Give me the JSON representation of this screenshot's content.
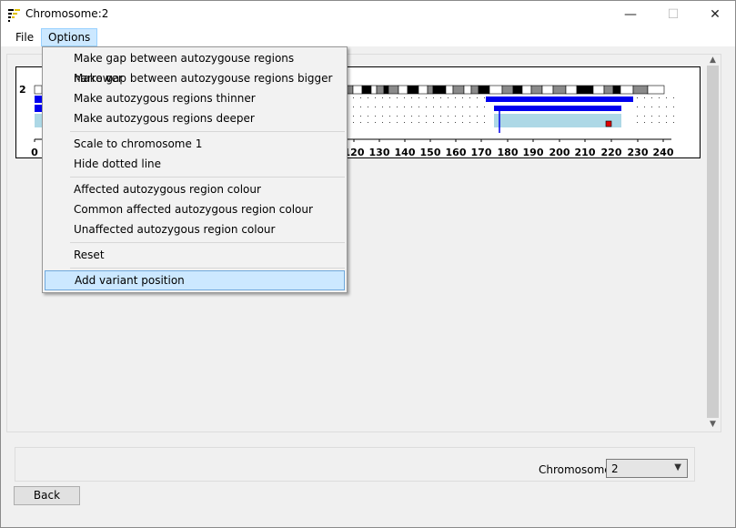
{
  "window": {
    "title": "Chromosome:2",
    "minimize": "—",
    "maximize": "☐",
    "close": "✕"
  },
  "menubar": {
    "file": "File",
    "options": "Options"
  },
  "options_menu": {
    "items": [
      "Make gap between autozygouse regions narrower",
      "Make gap between autozygouse regions bigger",
      "Make autozygous regions thinner",
      "Make autozygous regions deeper",
      "Scale to chromosome 1",
      "Hide dotted line",
      "Affected autozygous region colour",
      "Common affected autozygous region colour",
      "Unaffected autozygous region colour",
      "Reset",
      "Add variant position"
    ],
    "highlighted": "Add variant position"
  },
  "chart": {
    "chromosome_label": "2",
    "axis_ticks": [
      "0",
      "120",
      "130",
      "140",
      "150",
      "160",
      "170",
      "180",
      "190",
      "200",
      "210",
      "220",
      "230",
      "240"
    ],
    "colors": {
      "band_dark": "#000000",
      "band_mid": "#8a8a8a",
      "band_light": "#ffffff",
      "affected": "#0000ee",
      "region": "#add8e6",
      "variant": "#e00000"
    }
  },
  "bottom": {
    "chromosome_label": "Chromosome:",
    "chromosome_value": "2"
  },
  "back_button": "Back"
}
